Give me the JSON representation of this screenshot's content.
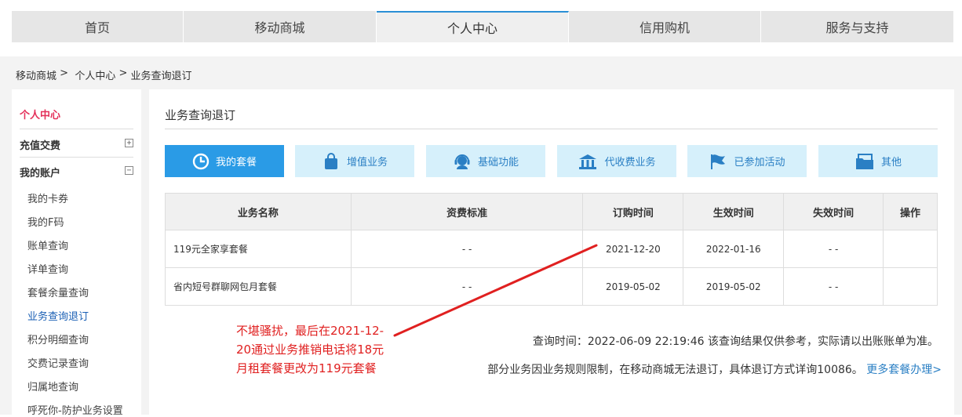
{
  "nav": {
    "tabs": [
      {
        "label": "首页",
        "active": false
      },
      {
        "label": "移动商城",
        "active": false
      },
      {
        "label": "个人中心",
        "active": true
      },
      {
        "label": "信用购机",
        "active": false
      },
      {
        "label": "服务与支持",
        "active": false
      }
    ]
  },
  "breadcrumb": {
    "items": [
      "移动商城",
      "个人中心",
      "业务查询退订"
    ],
    "separator": ">"
  },
  "sidebar": {
    "title": "个人中心",
    "sections": [
      {
        "label": "充值交费",
        "toggle": "+"
      },
      {
        "label": "我的账户",
        "toggle": "−"
      }
    ],
    "items": [
      {
        "label": "我的卡券",
        "active": false
      },
      {
        "label": "我的F码",
        "active": false
      },
      {
        "label": "账单查询",
        "active": false
      },
      {
        "label": "详单查询",
        "active": false
      },
      {
        "label": "套餐余量查询",
        "active": false
      },
      {
        "label": "业务查询退订",
        "active": true
      },
      {
        "label": "积分明细查询",
        "active": false
      },
      {
        "label": "交费记录查询",
        "active": false
      },
      {
        "label": "归属地查询",
        "active": false
      },
      {
        "label": "呼死你-防护业务设置",
        "active": false
      }
    ]
  },
  "main": {
    "title": "业务查询退订",
    "categories": [
      {
        "label": "我的套餐",
        "icon": "pie-clock-icon",
        "active": true
      },
      {
        "label": "增值业务",
        "icon": "shopping-bag-icon",
        "active": false
      },
      {
        "label": "基础功能",
        "icon": "headset-agent-icon",
        "active": false
      },
      {
        "label": "代收费业务",
        "icon": "bank-building-icon",
        "active": false
      },
      {
        "label": "已参加活动",
        "icon": "flag-icon",
        "active": false
      },
      {
        "label": "其他",
        "icon": "folder-card-icon",
        "active": false
      }
    ],
    "table": {
      "headers": [
        "业务名称",
        "资费标准",
        "订购时间",
        "生效时间",
        "失效时间",
        "操作"
      ],
      "rows": [
        [
          "119元全家享套餐",
          "- -",
          "2021-12-20",
          "2022-01-16",
          "- -",
          ""
        ],
        [
          "省内短号群聊网包月套餐",
          "- -",
          "2019-05-02",
          "2019-05-02",
          "- -",
          ""
        ]
      ]
    },
    "annotation": "不堪骚扰，最后在2021-12-20通过业务推销电话将18元月租套餐更改为119元套餐",
    "query_label": "查询时间：",
    "query_time": "2022-06-09 22:19:46",
    "query_note": "该查询结果仅供参考，实际请以出账账单为准。",
    "bottom_note": "部分业务因业务规则限制，在移动商城无法退订，具体退订方式详询10086。",
    "more_link": "更多套餐办理>"
  },
  "colors": {
    "accent": "#2a9be6",
    "category_bg": "#d6f0fb",
    "sidebar_title": "#e4305a",
    "annotation": "#e02020",
    "active_tab_border": "#2a8fd6"
  }
}
